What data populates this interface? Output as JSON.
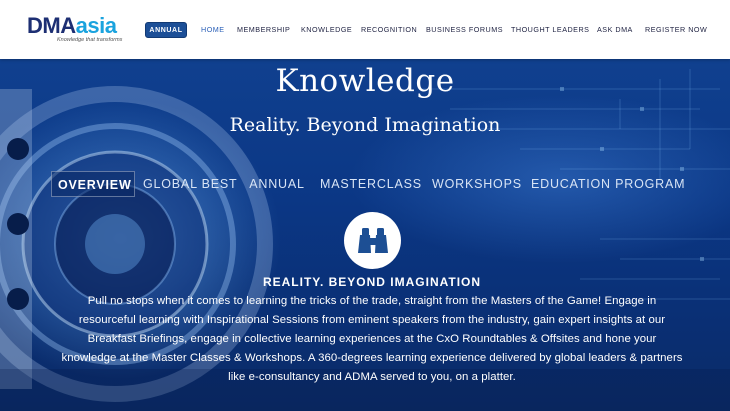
{
  "header": {
    "logo": {
      "brand_a": "DMA",
      "brand_b": "asia",
      "tagline": "Knowledge that transforms"
    },
    "annual_label": "ANNUAL",
    "nav": [
      "HOME",
      "MEMBERSHIP",
      "KNOWLEDGE",
      "RECOGNITION",
      "BUSINESS FORUMS",
      "THOUGHT LEADERS",
      "ASK DMA",
      "REGISTER NOW"
    ],
    "active_nav": "HOME"
  },
  "hero": {
    "title": "Knowledge",
    "subtitle": "Reality. Beyond Imagination",
    "tabs": [
      "OVERVIEW",
      "GLOBAL BEST",
      "ANNUAL",
      "MASTERCLASS",
      "WORKSHOPS",
      "EDUCATION PROGRAM"
    ],
    "active_tab": "OVERVIEW",
    "badge_icon": "binoculars-icon",
    "section_heading": "REALITY. BEYOND IMAGINATION",
    "body": "Pull no stops when it comes to learning the tricks of the trade, straight from the Masters of the Game! Engage in resourceful learning with Inspirational Sessions from eminent speakers from the industry, gain expert insights at our Breakfast Briefings, engage in collective learning experiences at the CxO Roundtables & Offsites and hone your knowledge at the Master Classes & Workshops. A 360-degrees learning experience delivered by global leaders & partners like e-consultancy and ADMA served to you, on a platter."
  },
  "colors": {
    "brand_navy": "#1d2f73",
    "brand_cyan": "#1aa3de",
    "annual_button": "#1c4f97",
    "nav_active": "#2a5fb7",
    "hero_blue": "#0b3785"
  }
}
